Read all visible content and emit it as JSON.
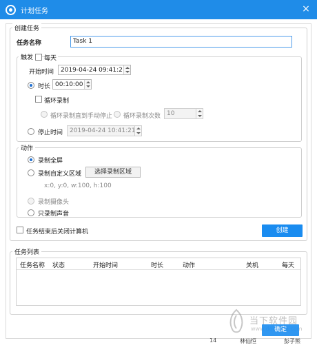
{
  "window": {
    "title": "计划任务",
    "close_glyph": "×"
  },
  "create_task": {
    "legend": "创建任务",
    "task_name_label": "任务名称",
    "task_name_value": "Task 1",
    "trigger": {
      "legend": "触发",
      "daily_label": "每天",
      "start_time_label": "开始时间",
      "start_time_value": "2019-04-24 09:41:21",
      "duration_label": "时长",
      "duration_value": "00:10:00",
      "loop_record_label": "循环录制",
      "loop_until_stop_label": "循环录制直到手动停止",
      "loop_count_label": "循环录制次数",
      "loop_count_value": "10",
      "stop_time_label": "停止时间",
      "stop_time_value": "2019-04-24 10:41:21"
    },
    "action": {
      "legend": "动作",
      "record_fullscreen_label": "录制全屏",
      "record_custom_area_label": "录制自定义区域",
      "select_area_button": "选择录制区域",
      "area_coords": "x:0, y:0, w:100, h:100",
      "record_camera_label": "录制摄像头",
      "record_audio_only_label": "只录制声音"
    },
    "shutdown_label": "任务结束后关闭计算机",
    "create_button": "创建"
  },
  "task_list": {
    "legend": "任务列表",
    "columns": [
      "任务名称",
      "状态",
      "开始时间",
      "时长",
      "动作",
      "关机",
      "每天"
    ]
  },
  "confirm_button": "确定",
  "watermark": {
    "brand": "当下软件园",
    "domain": "www.downxia.com"
  },
  "peek_text": [
    "14",
    "林仙恒",
    "彭子熊"
  ],
  "colors": {
    "accent": "#1f8ce8",
    "button_blue": "#1a8cf0"
  }
}
